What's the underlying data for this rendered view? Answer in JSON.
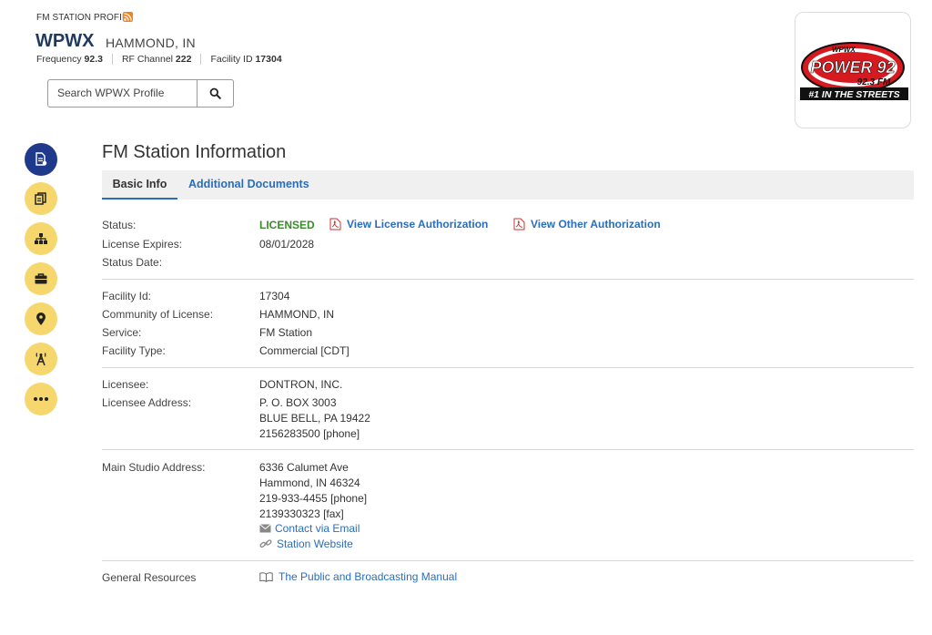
{
  "header": {
    "profile_label": "FM STATION PROFILE",
    "call_sign": "WPWX",
    "city": "HAMMOND, IN",
    "frequency_label": "Frequency",
    "frequency_value": "92.3",
    "rf_channel_label": "RF Channel",
    "rf_channel_value": "222",
    "facility_label": "Facility ID",
    "facility_value": "17304"
  },
  "search": {
    "placeholder": "Search WPWX Profile"
  },
  "logo": {
    "top_text": "WPWX",
    "main_text": "POWER 92",
    "freq_text": "92.3 FM",
    "tagline": "#1 IN THE STREETS"
  },
  "main": {
    "title": "FM Station Information",
    "tabs": [
      {
        "label": "Basic Info"
      },
      {
        "label": "Additional Documents"
      }
    ]
  },
  "status_block": {
    "status_label": "Status:",
    "status_value": "LICENSED",
    "license_link": "View License Authorization",
    "other_link": "View Other Authorization",
    "expires_label": "License Expires:",
    "expires_value": "08/01/2028",
    "status_date_label": "Status Date:"
  },
  "facility_block": {
    "facility_id_label": "Facility Id:",
    "facility_id_value": "17304",
    "community_label": "Community of License:",
    "community_value": "HAMMOND, IN",
    "service_label": "Service:",
    "service_value": "FM Station",
    "type_label": "Facility Type:",
    "type_value": "Commercial [CDT]"
  },
  "licensee_block": {
    "licensee_label": "Licensee:",
    "licensee_value": "DONTRON, INC.",
    "address_label": "Licensee Address:",
    "address_line1": "P. O. BOX 3003",
    "address_line2": "BLUE BELL, PA 19422",
    "address_phone": "2156283500 [phone]"
  },
  "studio_block": {
    "label": "Main Studio Address:",
    "line1": "6336 Calumet Ave",
    "line2": "Hammond, IN 46324",
    "phone": "219-933-4455 [phone]",
    "fax": "2139330323 [fax]",
    "email_link": "Contact via Email",
    "website_link": "Station Website"
  },
  "resources_block": {
    "label": "General Resources",
    "manual_link": "The Public and Broadcasting Manual"
  },
  "colors": {
    "accent": "#2a6ebb",
    "licensed": "#3c8a2e",
    "rail_active": "#1f3a8a",
    "rail": "#f5d76e"
  }
}
